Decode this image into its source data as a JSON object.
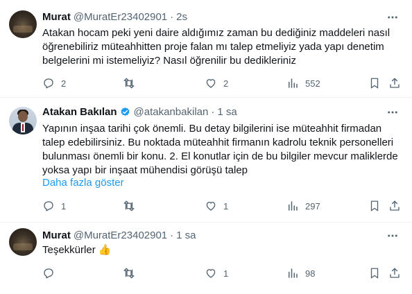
{
  "tweets": [
    {
      "name": "Murat",
      "handle": "@MuratEr23402901",
      "separator": "·",
      "time": "2s",
      "text": "Atakan hocam peki yeni daire aldığımız zaman bu dediğiniz maddeleri nasıl öğrenebiliriz müteahhitten proje falan mı talep etmeliyiz yada yapı denetim belgelerini mi istemeliyiz? Nasıl öğrenilir bu dedikleriniz",
      "replies": "2",
      "retweets": "",
      "likes": "2",
      "views": "552"
    },
    {
      "name": "Atakan Bakılan",
      "handle": "@atakanbakilan",
      "separator": "·",
      "time": "1 sa",
      "verified": true,
      "text": "Yapının inşaa tarihi çok önemli. Bu detay bilgilerini ise müteahhit firmadan talep edebilirsiniz. Bu noktada müteahhit firmanın kadrolu teknik personelleri bulunması önemli bir konu. 2. El konutlar için de bu bilgiler mevcur maliklerde yoksa yapı bir inşaat mühendisi görüşü talep",
      "show_more": "Daha fazla göster",
      "replies": "1",
      "retweets": "",
      "likes": "1",
      "views": "297"
    },
    {
      "name": "Murat",
      "handle": "@MuratEr23402901",
      "separator": "·",
      "time": "1 sa",
      "text": "Teşekkürler",
      "emoji": "👍",
      "replies": "",
      "retweets": "",
      "likes": "1",
      "views": "98"
    }
  ],
  "colors": {
    "secondary": "#536471",
    "link": "#1d9bf0",
    "verified": "#1d9bf0"
  },
  "icons": [
    "more-icon",
    "reply-icon",
    "retweet-icon",
    "like-icon",
    "views-icon",
    "bookmark-icon",
    "share-icon",
    "verified-icon"
  ]
}
